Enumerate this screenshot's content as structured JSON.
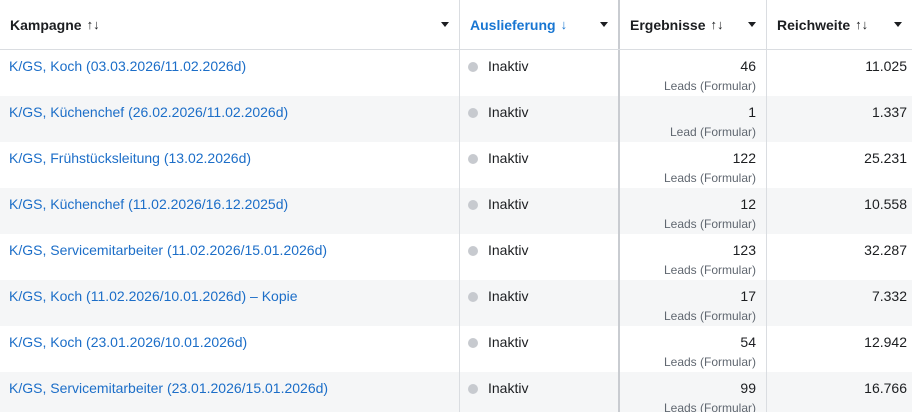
{
  "columns": [
    {
      "label": "Kampagne",
      "sort_icon": "↑↓"
    },
    {
      "label": "Auslieferung",
      "sort_icon": "↓"
    },
    {
      "label": "Ergebnisse",
      "sort_icon": "↑↓"
    },
    {
      "label": "Reichweite",
      "sort_icon": "↑↓"
    }
  ],
  "rows": [
    {
      "campaign": "K/GS, Koch (03.03.2026/11.02.2026d)",
      "status": "Inaktiv",
      "results": "46",
      "results_type": "Leads (Formular)",
      "reach": "11.025"
    },
    {
      "campaign": "K/GS, Küchenchef (26.02.2026/11.02.2026d)",
      "status": "Inaktiv",
      "results": "1",
      "results_type": "Lead (Formular)",
      "reach": "1.337"
    },
    {
      "campaign": "K/GS, Frühstücksleitung (13.02.2026d)",
      "status": "Inaktiv",
      "results": "122",
      "results_type": "Leads (Formular)",
      "reach": "25.231"
    },
    {
      "campaign": "K/GS, Küchenchef (11.02.2026/16.12.2025d)",
      "status": "Inaktiv",
      "results": "12",
      "results_type": "Leads (Formular)",
      "reach": "10.558"
    },
    {
      "campaign": "K/GS, Servicemitarbeiter (11.02.2026/15.01.2026d)",
      "status": "Inaktiv",
      "results": "123",
      "results_type": "Leads (Formular)",
      "reach": "32.287"
    },
    {
      "campaign": "K/GS, Koch (11.02.2026/10.01.2026d) – Kopie",
      "status": "Inaktiv",
      "results": "17",
      "results_type": "Leads (Formular)",
      "reach": "7.332"
    },
    {
      "campaign": "K/GS, Koch (23.01.2026/10.01.2026d)",
      "status": "Inaktiv",
      "results": "54",
      "results_type": "Leads (Formular)",
      "reach": "12.942"
    },
    {
      "campaign": "K/GS, Servicemitarbeiter (23.01.2026/15.01.2026d)",
      "status": "Inaktiv",
      "results": "99",
      "results_type": "Leads (Formular)",
      "reach": "16.766"
    }
  ],
  "colors": {
    "link": "#1c6ec8",
    "active_header": "#1876d2",
    "inactive_dot": "#c7cacf",
    "row_alt": "#f5f6f7"
  }
}
